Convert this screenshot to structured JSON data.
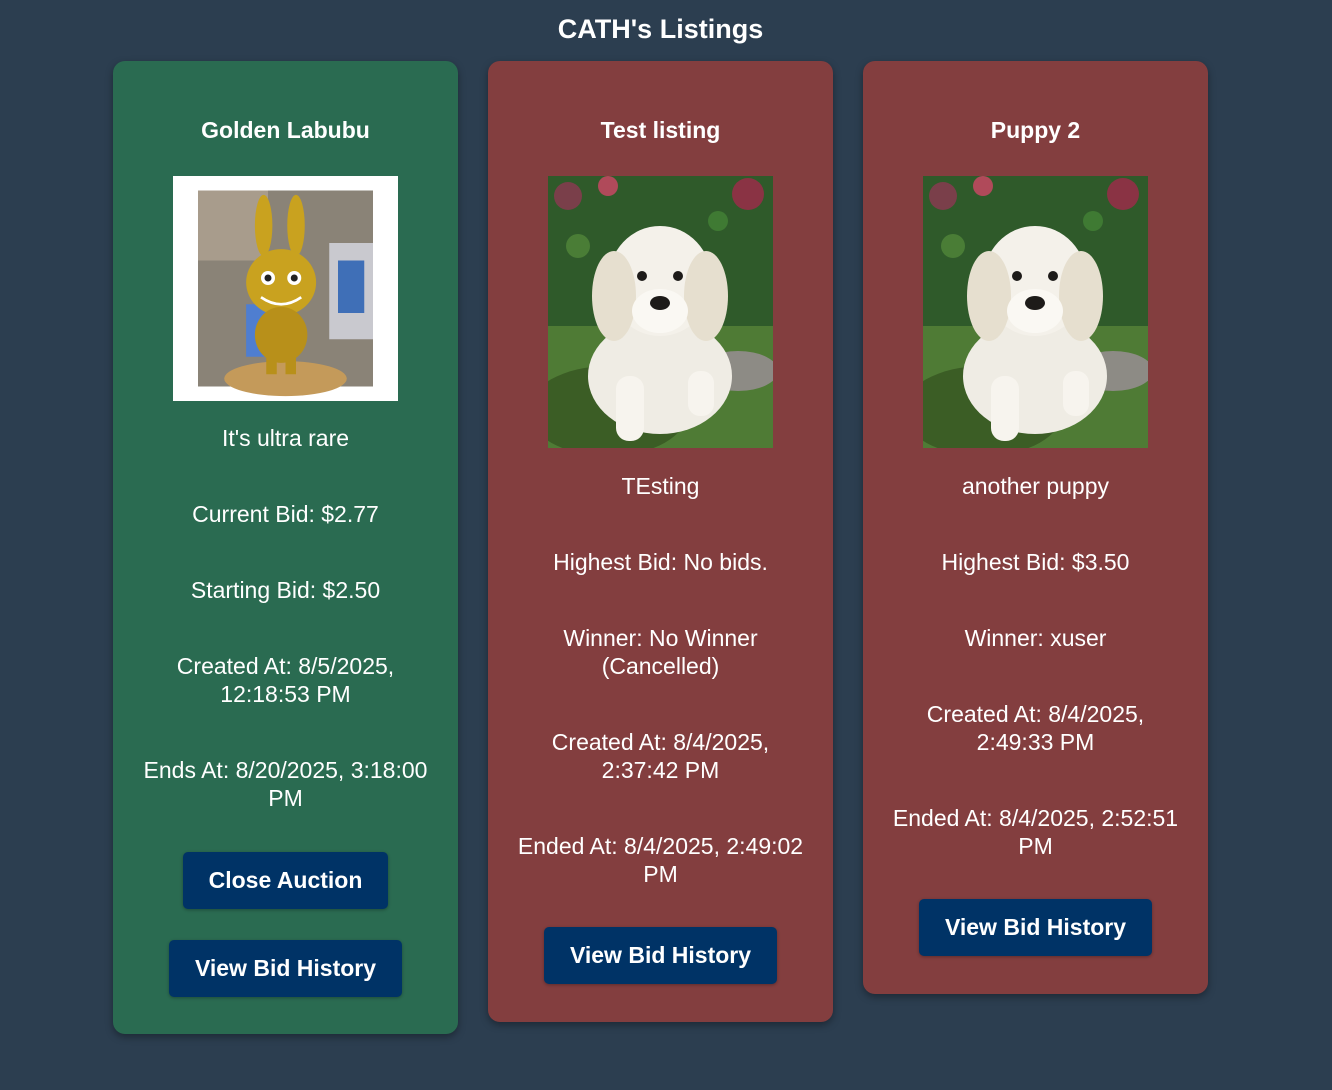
{
  "page": {
    "title": "CATH's Listings"
  },
  "colors": {
    "background": "#2c3e50",
    "active_card": "#2a6b51",
    "closed_card": "#833e3f",
    "button": "#003366"
  },
  "listings": [
    {
      "status": "active",
      "title": "Golden Labubu",
      "image": "golden-labubu-figure",
      "description": "It's ultra rare",
      "bid_line": "Current Bid: $2.77",
      "extra_line": "Starting Bid: $2.50",
      "created_line": "Created At: 8/5/2025, 12:18:53 PM",
      "end_line": "Ends At: 8/20/2025, 3:18:00 PM",
      "close_label": "Close Auction",
      "history_label": "View Bid History"
    },
    {
      "status": "closed",
      "title": "Test listing",
      "image": "white-puppy-photo",
      "description": "TEsting",
      "bid_line": "Highest Bid: No bids.",
      "extra_line": "Winner: No Winner (Cancelled)",
      "created_line": "Created At: 8/4/2025, 2:37:42 PM",
      "end_line": "Ended At: 8/4/2025, 2:49:02 PM",
      "history_label": "View Bid History"
    },
    {
      "status": "closed",
      "title": "Puppy 2",
      "image": "white-puppy-photo",
      "description": "another puppy",
      "bid_line": "Highest Bid: $3.50",
      "extra_line": "Winner: xuser",
      "created_line": "Created At: 8/4/2025, 2:49:33 PM",
      "end_line": "Ended At: 8/4/2025, 2:52:51 PM",
      "history_label": "View Bid History"
    }
  ]
}
